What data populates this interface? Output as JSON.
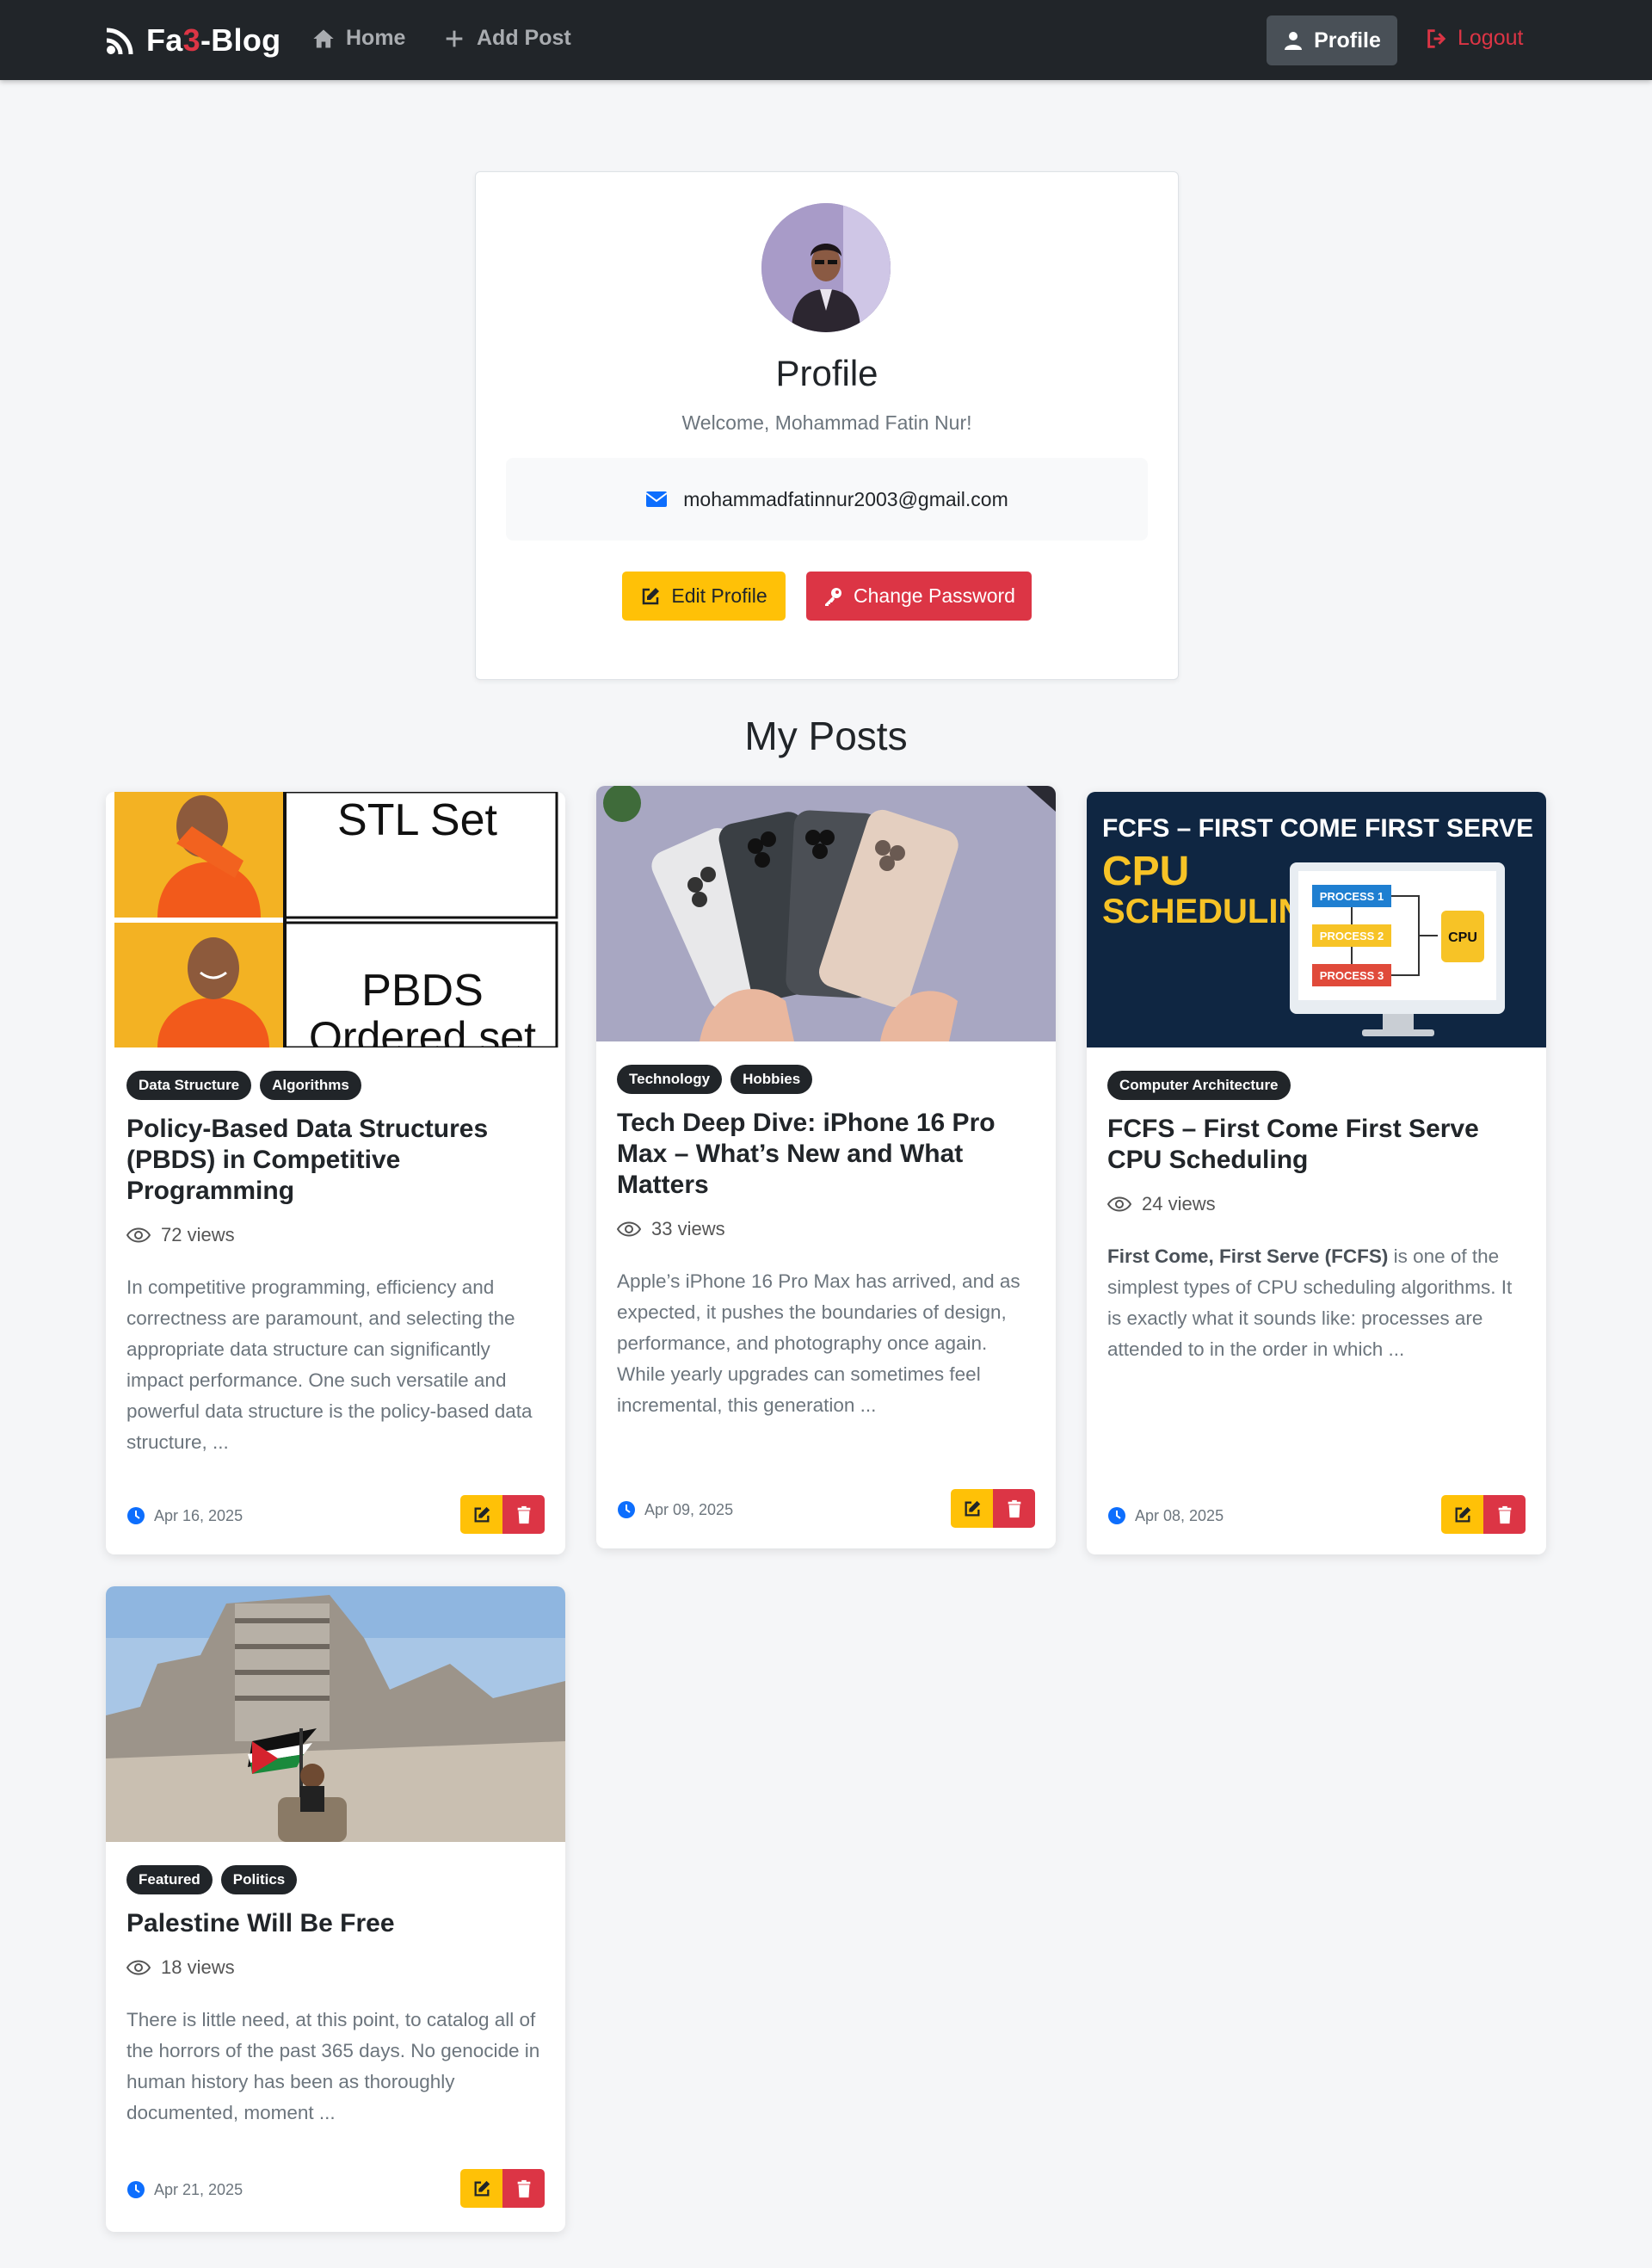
{
  "nav": {
    "brand_prefix": "Fa",
    "brand_accent": "3",
    "brand_suffix": "-Blog",
    "home": "Home",
    "add_post": "Add Post",
    "profile": "Profile",
    "logout": "Logout"
  },
  "profile": {
    "title": "Profile",
    "welcome": "Welcome, Mohammad Fatin Nur!",
    "email": "mohammadfatinnur2003@gmail.com",
    "edit_button": "Edit Profile",
    "change_password_button": "Change Password"
  },
  "section_title": "My Posts",
  "posts": [
    {
      "image_text_1": "STL Set",
      "image_text_2": "PBDS",
      "image_text_3": "Ordered set",
      "tags": [
        "Data Structure",
        "Algorithms"
      ],
      "title": "Policy-Based Data Structures (PBDS) in Competitive Programming",
      "views": "72 views",
      "excerpt": "In competitive programming, efficiency and correctness are paramount, and selecting the appropriate data structure can significantly impact performance. One such versatile and powerful data structure is the policy-based data structure, ...",
      "date": "Apr 16, 2025"
    },
    {
      "tags": [
        "Technology",
        "Hobbies"
      ],
      "title": "Tech Deep Dive: iPhone 16 Pro Max – What’s New and What Matters",
      "views": "33 views",
      "excerpt": "Apple’s iPhone 16 Pro Max has arrived, and as expected, it pushes the boundaries of design, performance, and photography once again. While yearly upgrades can sometimes feel incremental, this generation ...",
      "date": "Apr 09, 2025"
    },
    {
      "image_heading": "FCFS – FIRST COME FIRST SERVE",
      "image_title_1": "CPU",
      "image_title_2": "SCHEDULING",
      "image_process_1": "PROCESS 1",
      "image_process_2": "PROCESS 2",
      "image_process_3": "PROCESS 3",
      "image_cpu": "CPU",
      "tags": [
        "Computer Architecture"
      ],
      "title": "FCFS – First Come First Serve CPU Scheduling",
      "views": "24 views",
      "excerpt_bold": "First Come, First Serve (FCFS)",
      "excerpt": " is one of the simplest types of CPU scheduling algorithms. It is exactly what it sounds like: processes are attended to in the order in which ...",
      "date": "Apr 08, 2025"
    },
    {
      "tags": [
        "Featured",
        "Politics"
      ],
      "title": "Palestine Will Be Free",
      "views": "18 views",
      "excerpt": "There is little need, at this point, to catalog all of the horrors of the past 365 days. No genocide in human history has been as thoroughly documented, moment ...",
      "date": "Apr 21, 2025"
    }
  ]
}
